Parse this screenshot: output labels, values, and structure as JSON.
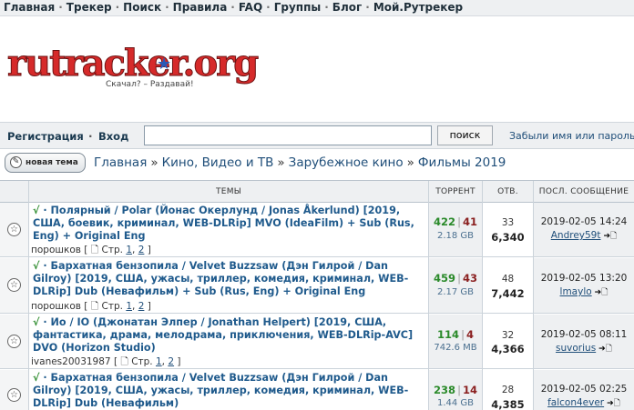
{
  "topnav": {
    "items": [
      "Главная",
      "Трекер",
      "Поиск",
      "Правила",
      "FAQ",
      "Группы",
      "Блог",
      "Мой.Рутрекер"
    ]
  },
  "logo": {
    "text_part1": "rutracker",
    "text_part2": ".org",
    "slogan": "Скачал? – Раздавай!"
  },
  "loginbar": {
    "register": "Регистрация",
    "separator": "·",
    "login": "Вход",
    "search_value": "",
    "search_button": "поиск",
    "forgot": "Забыли имя или пароль?"
  },
  "new_topic": {
    "label": "новая тема"
  },
  "breadcrumb": {
    "items": [
      "Главная",
      "Кино, Видео и ТВ",
      "Зарубежное кино",
      "Фильмы 2019"
    ],
    "separator": "»"
  },
  "table": {
    "headers": [
      "Темы",
      "Торрент",
      "Отв.",
      "Посл. сообщение"
    ],
    "rows": [
      {
        "title": "Полярный / Polar (Йонас Окерлунд / Jonas Åkerlund) [2019, США, боевик, криминал, WEB-DLRip] MVO (IdeaFilm) + Sub (Rus, Eng) + Original Eng",
        "check": "√",
        "dot": "·",
        "author": "порошков",
        "pages_label": "Стр.",
        "pages": [
          "1",
          "2"
        ],
        "seeds": "422",
        "leeches": "41",
        "size": "2.18 GB",
        "replies": "33",
        "views": "6,340",
        "last_date": "2019-02-05 14:24",
        "last_user": "Andrey59t"
      },
      {
        "title": "Бархатная бензопила / Velvet Buzzsaw (Дэн Гилрой / Dan Gilroy) [2019, США, ужасы, триллер, комедия, криминал, WEB-DLRip] Dub (Невафильм) + Sub (Rus, Eng) + Original Eng",
        "check": "√",
        "dot": "·",
        "author": "порошков",
        "pages_label": "Стр.",
        "pages": [
          "1",
          "2"
        ],
        "seeds": "459",
        "leeches": "43",
        "size": "2.17 GB",
        "replies": "48",
        "views": "7,442",
        "last_date": "2019-02-05 13:20",
        "last_user": "lmaylo"
      },
      {
        "title": "Ио / IO (Джонатан Элпер / Jonathan Helpert) [2019, США, фантастика, драма, мелодрама, приключения, WEB-DLRip-AVC] DVO (Horizon Studio)",
        "check": "√",
        "dot": "·",
        "author": "ivanes20031987",
        "pages_label": "Стр.",
        "pages": [
          "1",
          "2"
        ],
        "seeds": "114",
        "leeches": "4",
        "size": "742.6 MB",
        "replies": "32",
        "views": "4,366",
        "last_date": "2019-02-05 08:11",
        "last_user": "suvorius"
      },
      {
        "title": "Бархатная бензопила / Velvet Buzzsaw (Дэн Гилрой / Dan Gilroy) [2019, США, ужасы, триллер, комедия, криминал, WEB-DLRip] Dub (Невафильм)",
        "check": "√",
        "dot": "·",
        "author": "",
        "pages_label": "",
        "pages": [],
        "seeds": "238",
        "leeches": "14",
        "size": "1.44 GB",
        "replies": "28",
        "views": "4,385",
        "last_date": "2019-02-05 02:25",
        "last_user": "falcon4ever"
      }
    ]
  },
  "colors": {
    "seed": "#2a8a2a",
    "leech": "#8a1f1f",
    "link": "#1f5a8c"
  }
}
